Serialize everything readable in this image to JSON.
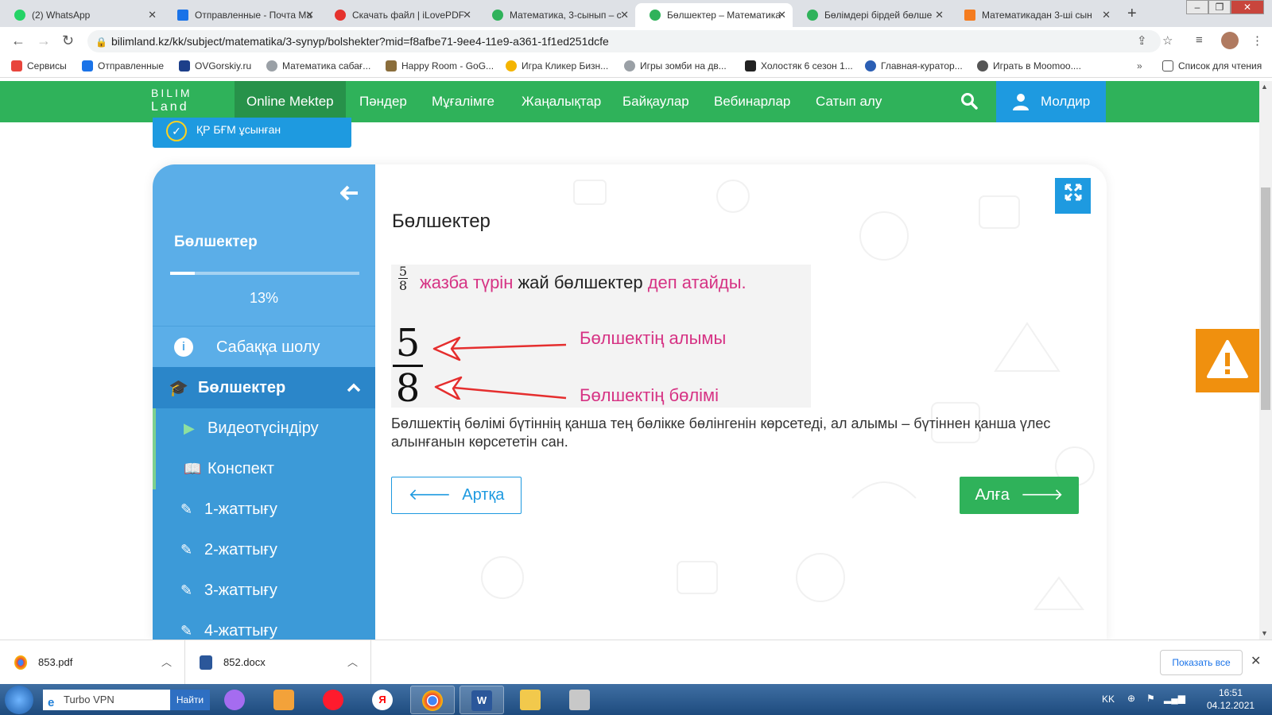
{
  "browser": {
    "tabs": [
      {
        "title": "(2) WhatsApp",
        "icon_color": "#25d366"
      },
      {
        "title": "Отправленные - Почта Ма",
        "icon_color": "#1a73e8"
      },
      {
        "title": "Скачать файл | iLovePDF",
        "icon_color": "#e5322d"
      },
      {
        "title": "Математика, 3-сынып – с",
        "icon_color": "#2fb25a"
      },
      {
        "title": "Бөлшектер – Математика",
        "icon_color": "#2fb25a"
      },
      {
        "title": "Бөлімдері бірдей бөлше",
        "icon_color": "#2fb25a"
      },
      {
        "title": "Математикадан 3-ші сын",
        "icon_color": "#f47c20"
      }
    ],
    "active_tab_index": 4,
    "url": "bilimland.kz/kk/subject/matematika/3-synyp/bolshekter?mid=f8afbe71-9ee4-11e9-a361-1f1ed251dcfe",
    "bookmarks": [
      {
        "label": "Сервисы",
        "color": "#e8453c"
      },
      {
        "label": "Отправленные",
        "color": "#1a73e8"
      },
      {
        "label": "OVGorskiy.ru",
        "color": "#1d3f8a"
      },
      {
        "label": "Математика сабағ...",
        "color": "#9aa0a6"
      },
      {
        "label": "Happy Room - GoG...",
        "color": "#8a6d3b"
      },
      {
        "label": "Игра Кликер Бизн...",
        "color": "#f4b400"
      },
      {
        "label": "Игры зомби на дв...",
        "color": "#9aa0a6"
      },
      {
        "label": "Холостяк 6 сезон 1...",
        "color": "#222222"
      },
      {
        "label": "Главная-куратор...",
        "color": "#2b5fb4"
      },
      {
        "label": "Играть в Moomoo....",
        "color": "#555555"
      }
    ],
    "reading_list": "Список для чтения"
  },
  "site": {
    "logo_line1": "BILIM",
    "logo_line2": "Land",
    "nav": [
      "Online Mektep",
      "Пәндер",
      "Мұғалімге",
      "Жаңалықтар",
      "Байқаулар",
      "Вебинарлар",
      "Сатып алу"
    ],
    "active_nav_index": 0,
    "user_name": "Молдир",
    "recommended_badge": "ҚР БҒМ ұсынған"
  },
  "lesson": {
    "sidebar_title": "Бөлшектер",
    "progress_percent": 13,
    "progress_label": "13%",
    "overview_label": "Сабаққа шолу",
    "section_label": "Бөлшектер",
    "items": [
      {
        "label": "Видеотүсіндіру",
        "icon": "play-icon"
      },
      {
        "label": "Конспект",
        "icon": "book-icon"
      },
      {
        "label": "1-жаттығу",
        "icon": "edit-icon"
      },
      {
        "label": "2-жаттығу",
        "icon": "edit-icon"
      },
      {
        "label": "3-жаттығу",
        "icon": "edit-icon"
      },
      {
        "label": "4-жаттығу",
        "icon": "edit-icon"
      }
    ],
    "content_title": "Бөлшектер",
    "figure": {
      "numerator": "5",
      "denominator": "8",
      "line1_part1": "жазба түрін",
      "line1_part2": "жай бөлшектер",
      "line1_part3": "деп атайды.",
      "numerator_label": "Бөлшектің алымы",
      "denominator_label": "Бөлшектің бөлімі"
    },
    "paragraph": "Бөлшектің бөлімі бүтіннің қанша тең бөлікке бөлінгенін көрсетеді, ал алымы – бүтіннен қанша үлес алынғанын көрсететін сан.",
    "back_label": "Артқа",
    "next_label": "Алға"
  },
  "downloads": {
    "files": [
      "853.pdf",
      "852.docx"
    ],
    "show_all": "Показать все"
  },
  "taskbar": {
    "search_text": "Turbo VPN",
    "find_label": "Найти",
    "lang": "KK",
    "time": "16:51",
    "date": "04.12.2021"
  },
  "colors": {
    "brand_green": "#2fb25a",
    "brand_blue": "#1e9ae0",
    "sidebar_blue": "#5baee8",
    "accent_pink": "#d63384",
    "alert_orange": "#f0900e"
  }
}
